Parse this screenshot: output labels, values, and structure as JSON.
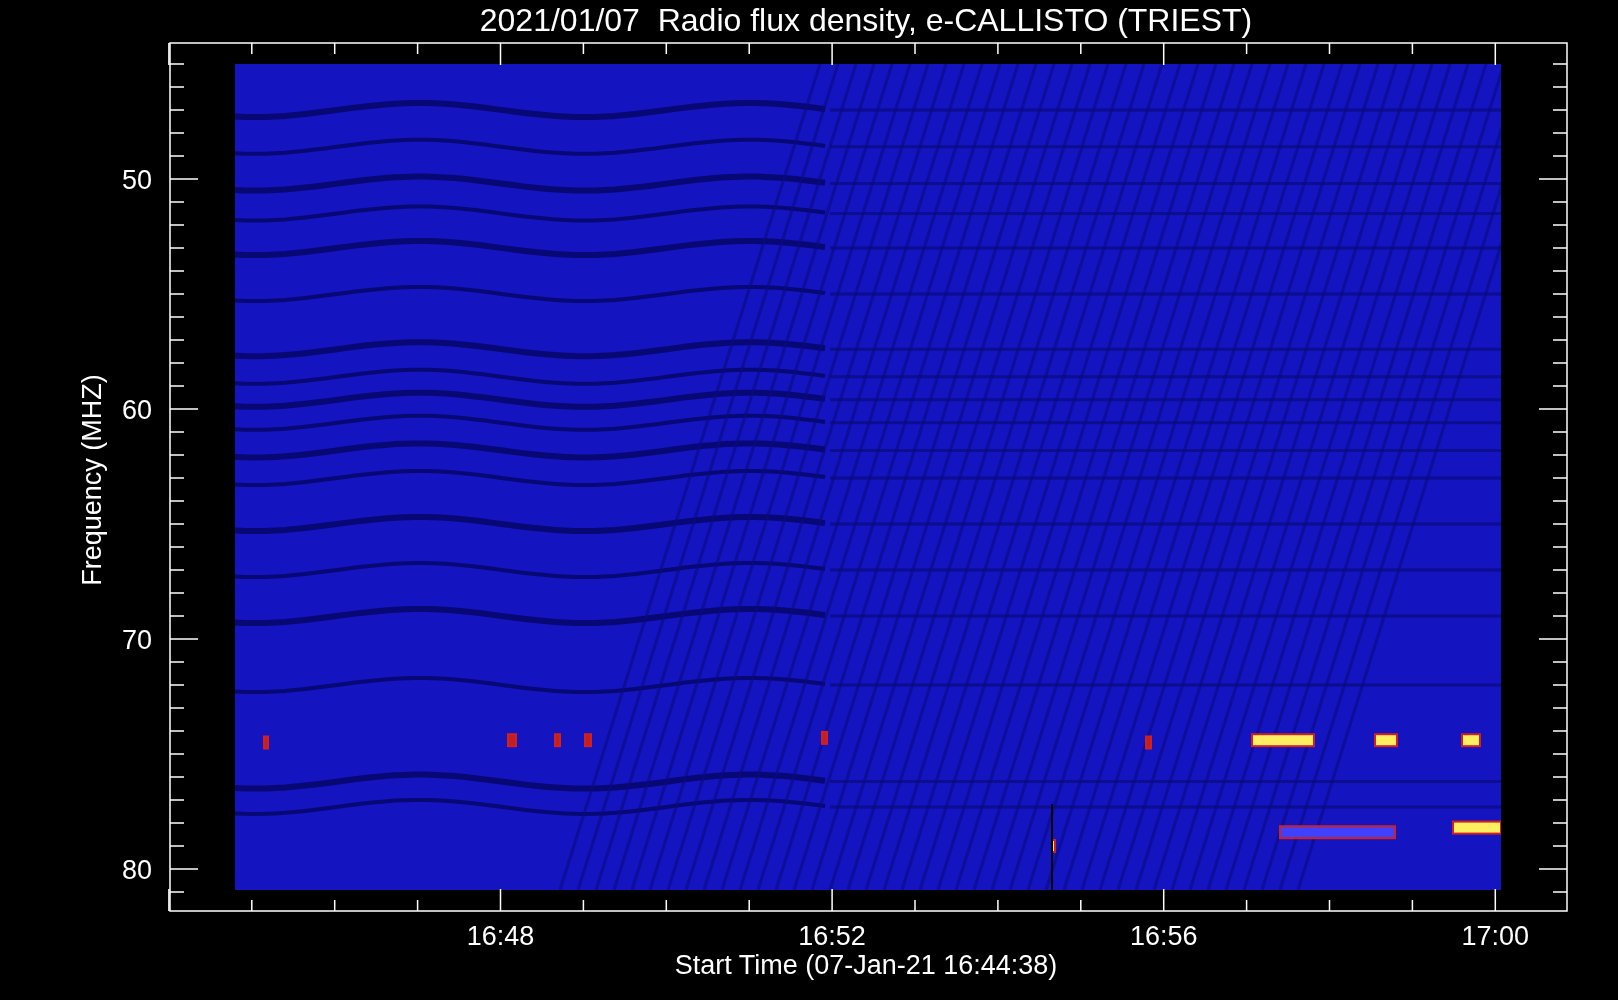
{
  "chart": {
    "title": "2021/01/07  Radio flux density, e-CALLISTO (TRIEST)",
    "x_axis": {
      "label": "Start Time (07-Jan-21 16:44:38)",
      "ticks": [
        "16:48",
        "16:52",
        "16:56",
        "17:00"
      ]
    },
    "y_axis": {
      "label": "Frequency (MHZ)",
      "ticks": [
        "50",
        "60",
        "70",
        "80"
      ]
    }
  }
}
